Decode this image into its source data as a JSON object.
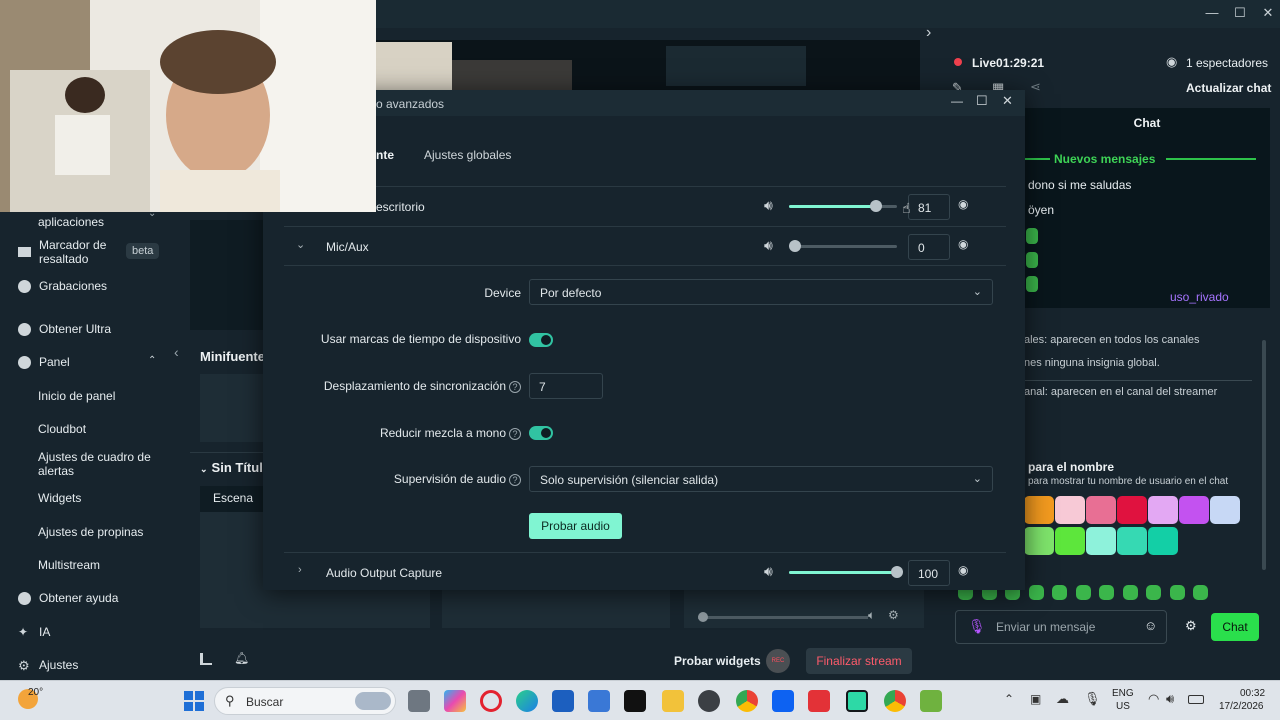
{
  "window": {
    "minimize": "—",
    "maximize": "☐",
    "close": "✕",
    "expand": "›"
  },
  "sidebar": {
    "aplicaciones": "aplicaciones",
    "marcador": "Marcador de resaltado",
    "beta": "beta",
    "grabaciones": "Grabaciones",
    "obtener_ultra": "Obtener Ultra",
    "panel": "Panel",
    "inicio_panel": "Inicio de panel",
    "cloudbot": "Cloudbot",
    "ajustes_alertas": "Ajustes de cuadro de alertas",
    "widgets": "Widgets",
    "ajustes_propinas": "Ajustes de propinas",
    "multistream": "Multistream",
    "obtener_ayuda": "Obtener ayuda",
    "ia": "IA",
    "ajustes": "Ajustes"
  },
  "editor": {
    "minifuente": "Minifuente",
    "sin_titulo": "Sin Títul",
    "escena": "Escena",
    "probar_widgets": "Probar widgets",
    "rec": "REC",
    "finalizar_stream": "Finalizar stream"
  },
  "live": {
    "status": "Live",
    "time": "01:29:21",
    "viewers": "1 espectadores",
    "actualizar_chat": "Actualizar chat"
  },
  "chat": {
    "title": "Chat",
    "nuevos_mensajes": "Nuevos mensajes",
    "msg1": "dono si me saludas",
    "msg2": "öyen",
    "user": "uso_rivado",
    "info1": "ales: aparecen en todos los canales",
    "info2": "nes ninguna insignia global.",
    "info3": "anal: aparecen en el canal del streamer",
    "color_title": "para el nombre",
    "color_desc": "para mostrar tu nombre de usuario en el chat",
    "placeholder": "Enviar un mensaje",
    "send": "Chat",
    "swatch_colors": [
      "#f29a1f",
      "#f7c9d6",
      "#e86f94",
      "#e0123f",
      "#e3a8f3",
      "#c352f0",
      "#c7d8f5",
      "#7ee36b",
      "#5de63c",
      "#8ef2db",
      "#36d9b3",
      "#13cfa6"
    ]
  },
  "modal": {
    "title": "o avanzados",
    "tab1": "nte",
    "tab2": "Ajustes globales",
    "row1": {
      "name": "escritorio",
      "value": "81",
      "level": 81
    },
    "row2": {
      "name": "Mic/Aux",
      "value": "0",
      "level": 0
    },
    "device_label": "Device",
    "device_value": "Por defecto",
    "timestamps_label": "Usar marcas de tiempo de dispositivo",
    "sync_label": "Desplazamiento de sincronización",
    "sync_value": "7",
    "mono_label": "Reducir mezcla a mono",
    "monitor_label": "Supervisión de audio",
    "monitor_value": "Solo supervisión (silenciar salida)",
    "test_button": "Probar audio",
    "row3": {
      "name": "Audio Output Capture",
      "value": "100",
      "level": 100
    }
  },
  "taskbar": {
    "weather": "20°",
    "search": "Buscar",
    "lang1": "ENG",
    "lang2": "US",
    "time": "00:32",
    "date": "17/2/2026"
  }
}
